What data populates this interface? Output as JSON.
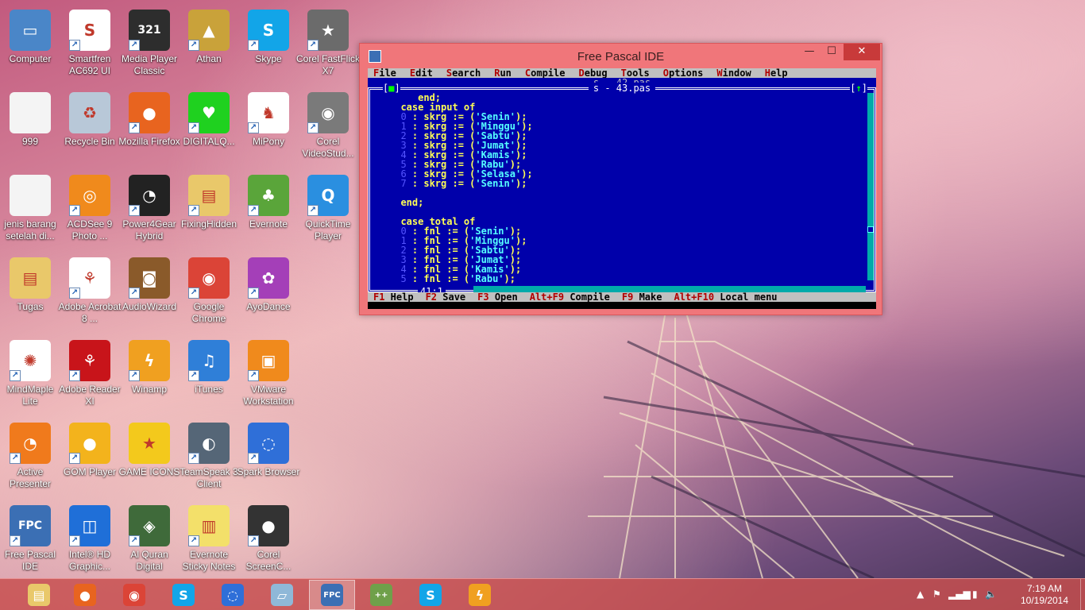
{
  "desktop": {
    "icons": [
      {
        "label": "Computer",
        "icon": "computer-icon",
        "color": "#4a86c8",
        "glyph": "▭",
        "shortcut": false
      },
      {
        "label": "Smartfren AC692 UI",
        "icon": "smartfren-icon",
        "color": "#ffffff",
        "glyph": "S",
        "shortcut": true
      },
      {
        "label": "Media Player Classic",
        "icon": "media-player-icon",
        "color": "#2d2d2d",
        "glyph": "321",
        "shortcut": true
      },
      {
        "label": "Athan",
        "icon": "athan-icon",
        "color": "#c9a23a",
        "glyph": "▲",
        "shortcut": true
      },
      {
        "label": "Skype",
        "icon": "skype-icon",
        "color": "#12a5e8",
        "glyph": "S",
        "shortcut": true
      },
      {
        "label": "Corel FastFlick X7",
        "icon": "corel-fastflick-icon",
        "color": "#6b6b6b",
        "glyph": "★",
        "shortcut": true
      },
      {
        "label": "999",
        "icon": "text-file-icon",
        "color": "#f4f4f4",
        "glyph": "",
        "shortcut": false
      },
      {
        "label": "Recycle Bin",
        "icon": "recycle-bin-icon",
        "color": "#b8c8d8",
        "glyph": "♻",
        "shortcut": false
      },
      {
        "label": "Mozilla Firefox",
        "icon": "firefox-icon",
        "color": "#e8641f",
        "glyph": "●",
        "shortcut": true
      },
      {
        "label": "DIGITALQ...",
        "icon": "heart-icon",
        "color": "#1fd11f",
        "glyph": "♥",
        "shortcut": true
      },
      {
        "label": "MiPony",
        "icon": "mipony-icon",
        "color": "#ffffff",
        "glyph": "♞",
        "shortcut": true
      },
      {
        "label": "Corel VideoStud...",
        "icon": "corel-videostudio-icon",
        "color": "#7a7a7a",
        "glyph": "◉",
        "shortcut": true
      },
      {
        "label": "jenis barang setelah di...",
        "icon": "text-file-icon",
        "color": "#f4f4f4",
        "glyph": "",
        "shortcut": false
      },
      {
        "label": "ACDSee 9 Photo ...",
        "icon": "acdsee-icon",
        "color": "#f08a1c",
        "glyph": "◎",
        "shortcut": true
      },
      {
        "label": "Power4Gear Hybrid",
        "icon": "power4gear-icon",
        "color": "#222222",
        "glyph": "◔",
        "shortcut": true
      },
      {
        "label": "FixingHidden",
        "icon": "folder-icon",
        "color": "#e9c86a",
        "glyph": "▤",
        "shortcut": true
      },
      {
        "label": "Evernote",
        "icon": "evernote-icon",
        "color": "#5aa53a",
        "glyph": "♣",
        "shortcut": true
      },
      {
        "label": "QuickTime Player",
        "icon": "quicktime-icon",
        "color": "#2a8fe0",
        "glyph": "Q",
        "shortcut": true
      },
      {
        "label": "Tugas",
        "icon": "folder-icon",
        "color": "#e9c86a",
        "glyph": "▤",
        "shortcut": false
      },
      {
        "label": "Adobe Acrobat 8 ...",
        "icon": "adobe-acrobat-icon",
        "color": "#ffffff",
        "glyph": "⚘",
        "shortcut": true
      },
      {
        "label": "AudioWizard",
        "icon": "audiowizard-icon",
        "color": "#8a5a2a",
        "glyph": "◙",
        "shortcut": true
      },
      {
        "label": "Google Chrome",
        "icon": "chrome-icon",
        "color": "#db4437",
        "glyph": "◉",
        "shortcut": true
      },
      {
        "label": "AyoDance",
        "icon": "ayodance-icon",
        "color": "#a43fb8",
        "glyph": "✿",
        "shortcut": true
      },
      {
        "label": "MindMaple Lite",
        "icon": "mindmaple-icon",
        "color": "#ffffff",
        "glyph": "✺",
        "shortcut": true
      },
      {
        "label": "Adobe Reader XI",
        "icon": "adobe-reader-icon",
        "color": "#c8141a",
        "glyph": "⚘",
        "shortcut": true
      },
      {
        "label": "Winamp",
        "icon": "winamp-icon",
        "color": "#f0a020",
        "glyph": "ϟ",
        "shortcut": true
      },
      {
        "label": "iTunes",
        "icon": "itunes-icon",
        "color": "#2f7fd8",
        "glyph": "♫",
        "shortcut": true
      },
      {
        "label": "VMware Workstation",
        "icon": "vmware-icon",
        "color": "#f08a1c",
        "glyph": "▣",
        "shortcut": true
      },
      {
        "label": "Active Presenter",
        "icon": "activepresenter-icon",
        "color": "#f07a1c",
        "glyph": "◔",
        "shortcut": true
      },
      {
        "label": "GOM Player",
        "icon": "gom-player-icon",
        "color": "#f3b31c",
        "glyph": "●",
        "shortcut": true
      },
      {
        "label": "GAME ICONS",
        "icon": "star-icon",
        "color": "#f3c91c",
        "glyph": "★",
        "shortcut": false
      },
      {
        "label": "TeamSpeak 3 Client",
        "icon": "teamspeak-icon",
        "color": "#556677",
        "glyph": "◐",
        "shortcut": true
      },
      {
        "label": "Spark Browser",
        "icon": "spark-browser-icon",
        "color": "#2f6fd8",
        "glyph": "◌",
        "shortcut": true
      },
      {
        "label": "Free Pascal IDE",
        "icon": "free-pascal-icon",
        "color": "#3b6fb4",
        "glyph": "FPC",
        "shortcut": true
      },
      {
        "label": "Intel® HD Graphic...",
        "icon": "intel-graphics-icon",
        "color": "#1f6fd8",
        "glyph": "◫",
        "shortcut": true
      },
      {
        "label": "Al Quran Digital",
        "icon": "al-quran-icon",
        "color": "#3f6a3a",
        "glyph": "◈",
        "shortcut": true
      },
      {
        "label": "Evernote Sticky Notes",
        "icon": "sticky-notes-icon",
        "color": "#f3e06a",
        "glyph": "▥",
        "shortcut": true
      },
      {
        "label": "Corel ScreenC...",
        "icon": "corel-screencap-icon",
        "color": "#333333",
        "glyph": "●",
        "shortcut": true
      }
    ]
  },
  "fp_window": {
    "title": "Free Pascal IDE",
    "min_glyph": "—",
    "max_glyph": "☐",
    "close_glyph": "✕",
    "menu": [
      {
        "hk": "F",
        "rest": "ile"
      },
      {
        "hk": "E",
        "rest": "dit"
      },
      {
        "hk": "S",
        "rest": "earch"
      },
      {
        "hk": "R",
        "rest": "un"
      },
      {
        "hk": "C",
        "rest": "ompile"
      },
      {
        "hk": "D",
        "rest": "ebug"
      },
      {
        "hk": "T",
        "rest": "ools"
      },
      {
        "hk": "O",
        "rest": "ptions"
      },
      {
        "hk": "W",
        "rest": "indow"
      },
      {
        "hk": "H",
        "rest": "elp"
      }
    ],
    "back_window_title": "s - 42.pas",
    "editor_title": "s - 43.pas",
    "close_box": "[■]",
    "zoom_box": "[↑]",
    "cursor_pos": "41:1",
    "code_lines": [
      {
        "indent": "     ",
        "num": "",
        "kw": "end;",
        "mid": "",
        "str": "",
        "tail": ""
      },
      {
        "indent": "  ",
        "num": "",
        "kw": "case input of",
        "mid": "",
        "str": "",
        "tail": ""
      },
      {
        "indent": "  ",
        "num": "0",
        "kw": " : skrg := (",
        "mid": "",
        "str": "'Senin'",
        "tail": ");"
      },
      {
        "indent": "  ",
        "num": "1",
        "kw": " : skrg := (",
        "mid": "",
        "str": "'Minggu'",
        "tail": ");"
      },
      {
        "indent": "  ",
        "num": "2",
        "kw": " : skrg := (",
        "mid": "",
        "str": "'Sabtu'",
        "tail": ");"
      },
      {
        "indent": "  ",
        "num": "3",
        "kw": " : skrg := (",
        "mid": "",
        "str": "'Jumat'",
        "tail": ");"
      },
      {
        "indent": "  ",
        "num": "4",
        "kw": " : skrg := (",
        "mid": "",
        "str": "'Kamis'",
        "tail": ");"
      },
      {
        "indent": "  ",
        "num": "5",
        "kw": " : skrg := (",
        "mid": "",
        "str": "'Rabu'",
        "tail": ");"
      },
      {
        "indent": "  ",
        "num": "6",
        "kw": " : skrg := (",
        "mid": "",
        "str": "'Selasa'",
        "tail": ");"
      },
      {
        "indent": "  ",
        "num": "7",
        "kw": " : skrg := (",
        "mid": "",
        "str": "'Senin'",
        "tail": ");"
      },
      {
        "indent": "",
        "num": "",
        "kw": "",
        "mid": "",
        "str": "",
        "tail": ""
      },
      {
        "indent": "  ",
        "num": "",
        "kw": "end;",
        "mid": "",
        "str": "",
        "tail": ""
      },
      {
        "indent": "",
        "num": "",
        "kw": "",
        "mid": "",
        "str": "",
        "tail": ""
      },
      {
        "indent": "  ",
        "num": "",
        "kw": "case total of",
        "mid": "",
        "str": "",
        "tail": ""
      },
      {
        "indent": "  ",
        "num": "0",
        "kw": " : fnl := (",
        "mid": "",
        "str": "'Senin'",
        "tail": ");"
      },
      {
        "indent": "  ",
        "num": "1",
        "kw": " : fnl := (",
        "mid": "",
        "str": "'Minggu'",
        "tail": ");"
      },
      {
        "indent": "  ",
        "num": "2",
        "kw": " : fnl := (",
        "mid": "",
        "str": "'Sabtu'",
        "tail": ");"
      },
      {
        "indent": "  ",
        "num": "3",
        "kw": " : fnl := (",
        "mid": "",
        "str": "'Jumat'",
        "tail": ");"
      },
      {
        "indent": "  ",
        "num": "4",
        "kw": " : fnl := (",
        "mid": "",
        "str": "'Kamis'",
        "tail": ");"
      },
      {
        "indent": "  ",
        "num": "5",
        "kw": " : fnl := (",
        "mid": "",
        "str": "'Rabu'",
        "tail": ");"
      }
    ],
    "status": [
      {
        "hk": "F1",
        "rest": " Help"
      },
      {
        "hk": "F2",
        "rest": " Save"
      },
      {
        "hk": "F3",
        "rest": " Open"
      },
      {
        "hk": "Alt+F9",
        "rest": " Compile"
      },
      {
        "hk": "F9",
        "rest": " Make"
      },
      {
        "hk": "Alt+F10",
        "rest": " Local menu"
      }
    ]
  },
  "taskbar": {
    "items": [
      {
        "name": "file-explorer",
        "icon": "folder-icon",
        "color": "#e9c86a",
        "glyph": "▤",
        "active": false
      },
      {
        "name": "firefox",
        "icon": "firefox-icon",
        "color": "#e8641f",
        "glyph": "●",
        "active": false
      },
      {
        "name": "chrome",
        "icon": "chrome-icon",
        "color": "#db4437",
        "glyph": "◉",
        "active": false
      },
      {
        "name": "skype",
        "icon": "skype-icon",
        "color": "#12a5e8",
        "glyph": "S",
        "active": false
      },
      {
        "name": "spark-browser",
        "icon": "spark-browser-icon",
        "color": "#2f6fd8",
        "glyph": "◌",
        "active": false
      },
      {
        "name": "notepad",
        "icon": "notepad-icon",
        "color": "#8fb8d8",
        "glyph": "▱",
        "active": false
      },
      {
        "name": "free-pascal",
        "icon": "free-pascal-icon",
        "color": "#3b6fb4",
        "glyph": "FPC",
        "active": true
      },
      {
        "name": "notepad-plus",
        "icon": "notepad-plus-icon",
        "color": "#6fa04a",
        "glyph": "++",
        "active": false
      },
      {
        "name": "skype-2",
        "icon": "skype-icon",
        "color": "#12a5e8",
        "glyph": "S",
        "active": false
      },
      {
        "name": "winamp",
        "icon": "winamp-icon",
        "color": "#f0a020",
        "glyph": "ϟ",
        "active": false
      }
    ],
    "tray": {
      "chevron": "▲",
      "flag": "⚑",
      "signal": "▂▄▆",
      "battery": "▮",
      "volume": "🔈"
    },
    "time": "7:19 AM",
    "date": "10/19/2014"
  }
}
